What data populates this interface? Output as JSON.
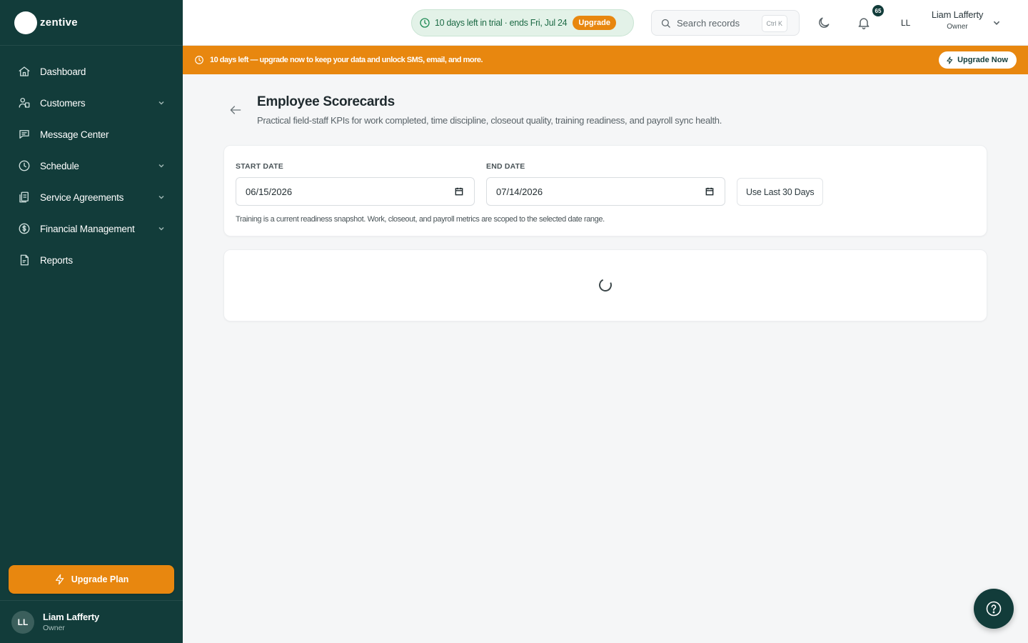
{
  "brand": {
    "name": "zentive"
  },
  "sidebar": {
    "items": [
      {
        "label": "Dashboard",
        "icon": "home-icon",
        "expandable": false
      },
      {
        "label": "Customers",
        "icon": "users-icon",
        "expandable": true
      },
      {
        "label": "Message Center",
        "icon": "message-icon",
        "expandable": false
      },
      {
        "label": "Schedule",
        "icon": "clock-icon",
        "expandable": true
      },
      {
        "label": "Service Agreements",
        "icon": "agreements-icon",
        "expandable": true
      },
      {
        "label": "Financial Management",
        "icon": "dollar-icon",
        "expandable": true
      },
      {
        "label": "Reports",
        "icon": "report-icon",
        "expandable": false
      }
    ],
    "upgrade_label": "Upgrade Plan",
    "user": {
      "initials": "LL",
      "name": "Liam Lafferty",
      "role": "Owner"
    }
  },
  "topbar": {
    "trial_text": "10 days left in trial · ends Fri, Jul 24",
    "trial_button": "Upgrade",
    "search_placeholder": "Search records",
    "search_shortcut": "Ctrl K",
    "notification_count": "65",
    "user_initials": "LL",
    "user_name": "Liam Lafferty",
    "user_role": "Owner"
  },
  "banner": {
    "text": "10 days left — upgrade now to keep your data and unlock SMS, email, and more.",
    "button": "Upgrade Now"
  },
  "page": {
    "title": "Employee Scorecards",
    "subtitle": "Practical field-staff KPIs for work completed, time discipline, closeout quality, training readiness, and payroll sync health."
  },
  "filters": {
    "start_label": "START DATE",
    "start_value": "06/15/2026",
    "end_label": "END DATE",
    "end_value": "07/14/2026",
    "last30_label": "Use Last 30 Days",
    "note": "Training is a current readiness snapshot. Work, closeout, and payroll metrics are scoped to the selected date range."
  },
  "colors": {
    "sidebar_bg": "#123c3a",
    "accent_orange": "#e8870f",
    "trial_green": "#e3f2e8"
  }
}
